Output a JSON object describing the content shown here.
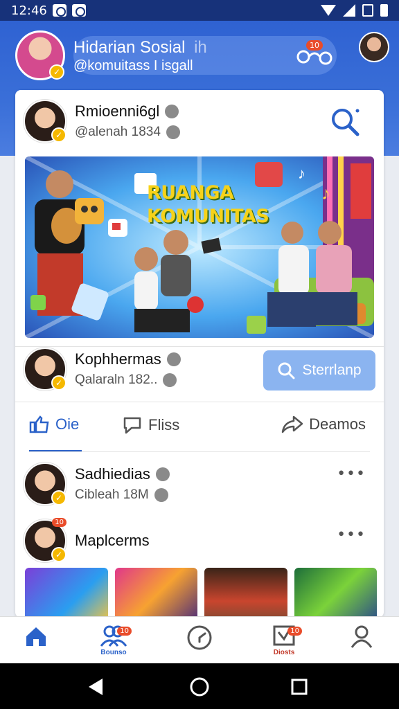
{
  "status": {
    "time": "12:46"
  },
  "profile": {
    "name": "Hidarian Sosial",
    "name_suffix": "ih",
    "handle": "@komuitass I isgall",
    "notif_count": "10"
  },
  "post": {
    "author": "Rmioenni6gl",
    "sub": "@alenah 1834",
    "banner_title_1": "RUANGA",
    "banner_title_2": "KOMUNITAS"
  },
  "repost": {
    "author": "Kophhermas",
    "sub": "Qalaraln 182..",
    "follow_label": "Sterrlanp"
  },
  "actions": {
    "like": "Oie",
    "comment": "Fliss",
    "share": "Deamos"
  },
  "comments": [
    {
      "name": "Sadhiedias",
      "sub": "Cibleah 18M",
      "more": "•••"
    },
    {
      "name": "Maplcerms",
      "more": "•••"
    }
  ],
  "nav": {
    "friends_label": "Bounso",
    "friends_badge": "10",
    "notif_label": "Diosts",
    "notif_badge": "10"
  },
  "colors": {
    "primary": "#2f62d2",
    "accent_blue": "#2b62c9",
    "badge": "#e94c2a",
    "verify": "#f5b800"
  }
}
